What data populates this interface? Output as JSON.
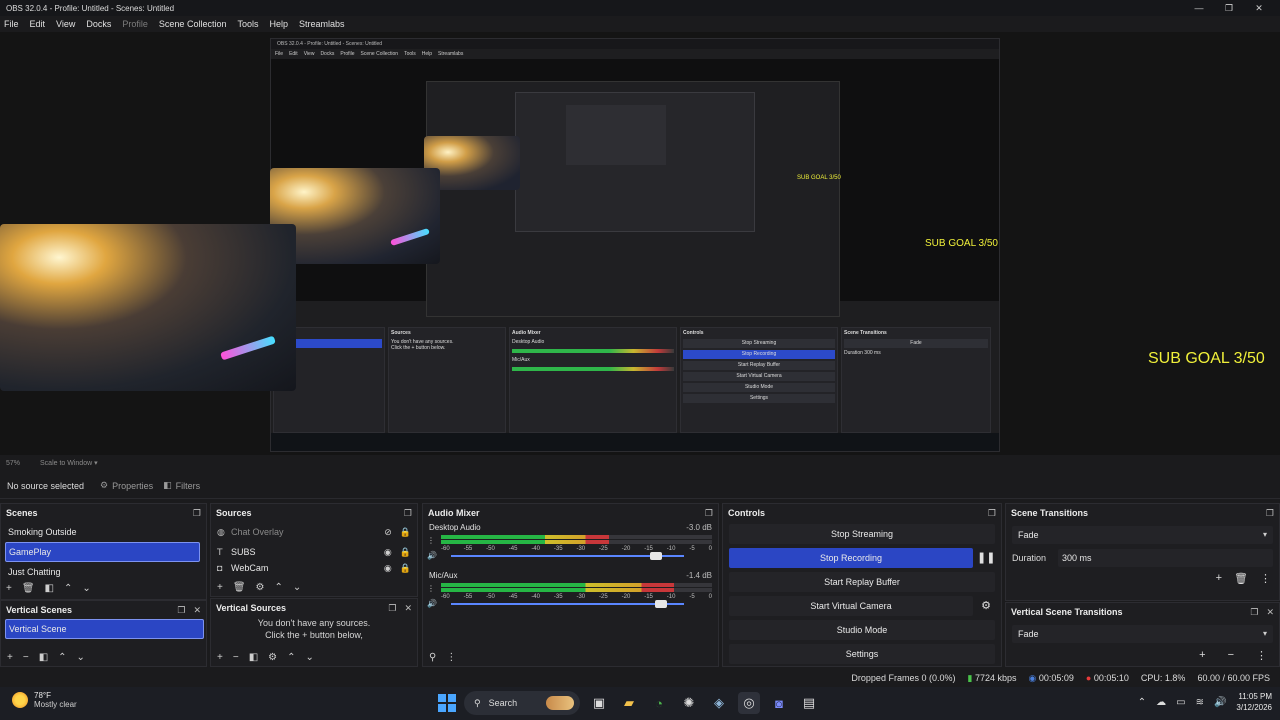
{
  "window": {
    "title": "OBS 32.0.4 - Profile: Untitled - Scenes: Untitled",
    "controls": [
      "—",
      "❐",
      "✕"
    ]
  },
  "menu": [
    "File",
    "Edit",
    "View",
    "Docks",
    "Profile",
    "Scene Collection",
    "Tools",
    "Help",
    "Streamlabs"
  ],
  "preview": {
    "overlay_text": "SUB GOAL 3/50",
    "nested_title": "OBS 32.0.4 - Profile: Untitled - Scenes: Untitled",
    "nested_menu": [
      "File",
      "Edit",
      "View",
      "Docks",
      "Profile",
      "Scene Collection",
      "Tools",
      "Help",
      "Streamlabs"
    ],
    "nested_panels": {
      "scenes": "Scenes",
      "sources": "Sources",
      "mixer": "Audio Mixer",
      "controls": "Controls",
      "transitions": "Scene Transitions",
      "desktop_audio": "Desktop Audio",
      "mic": "Mic/Aux",
      "stop_streaming": "Stop Streaming",
      "stop_recording": "Stop Recording",
      "start_replay": "Start Replay Buffer",
      "start_vcam": "Start Virtual Camera",
      "studio_mode": "Studio Mode",
      "settings": "Settings",
      "fade": "Fade",
      "duration": "Duration",
      "duration_val": "300 ms",
      "no_sources": "You don't have any sources.",
      "click_plus": "Click the + button below."
    }
  },
  "preview_status": {
    "zoom": "57%",
    "scale": "Scale to Window"
  },
  "source_bar": {
    "no_source": "No source selected",
    "properties": "Properties",
    "filters": "Filters"
  },
  "scenes": {
    "title": "Scenes",
    "items": [
      "Smoking Outside",
      "GamePlay",
      "Just Chatting"
    ],
    "selected": "GamePlay"
  },
  "vertical_scenes": {
    "title": "Vertical Scenes",
    "items": [
      "Vertical Scene"
    ]
  },
  "sources": {
    "title": "Sources",
    "items": [
      {
        "name": "Chat Overlay",
        "icon": "browser-icon"
      },
      {
        "name": "SUBS",
        "icon": "text-icon"
      },
      {
        "name": "WebCam",
        "icon": "camera-icon"
      }
    ]
  },
  "vertical_sources": {
    "title": "Vertical Sources",
    "empty_line1": "You don't have any sources.",
    "empty_line2": "Click the + button below,"
  },
  "mixer": {
    "title": "Audio Mixer",
    "channels": [
      {
        "name": "Desktop Audio",
        "db": "-3.0 dB",
        "level": 0.62,
        "fader": 0.88
      },
      {
        "name": "Mic/Aux",
        "db": "-1.4 dB",
        "level": 0.86,
        "fader": 0.9
      }
    ],
    "scale": [
      "-60",
      "-55",
      "-50",
      "-45",
      "-40",
      "-35",
      "-30",
      "-25",
      "-20",
      "-15",
      "-10",
      "-5",
      "0"
    ]
  },
  "controls": {
    "title": "Controls",
    "stop_streaming": "Stop Streaming",
    "stop_recording": "Stop Recording",
    "start_replay": "Start Replay Buffer",
    "start_vcam": "Start Virtual Camera",
    "studio_mode": "Studio Mode",
    "settings": "Settings"
  },
  "transitions": {
    "title": "Scene Transitions",
    "selected": "Fade",
    "duration_label": "Duration",
    "duration_value": "300 ms"
  },
  "vertical_transitions": {
    "title": "Vertical Scene Transitions",
    "selected": "Fade"
  },
  "status": {
    "dropped": "Dropped Frames 0 (0.0%)",
    "kbps": "7724 kbps",
    "stream_time": "00:05:09",
    "rec_time": "00:05:10",
    "cpu": "CPU: 1.8%",
    "fps": "60.00 / 60.00 FPS"
  },
  "taskbar": {
    "temp": "78°F",
    "weather": "Mostly clear",
    "search": "Search",
    "time": "11:05 PM",
    "date": "3/12/2026"
  },
  "colors": {
    "accent": "#2b46c4",
    "overlay_yellow": "#f0f03a",
    "record_red": "#e83a3a"
  }
}
